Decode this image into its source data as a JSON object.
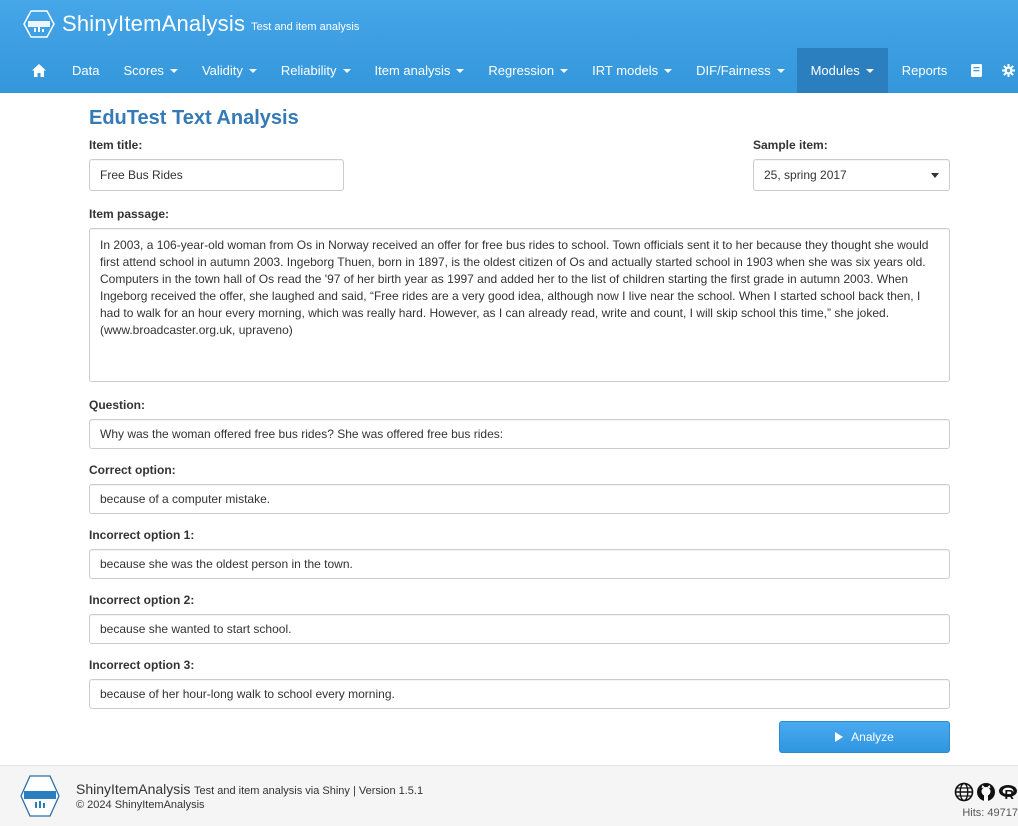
{
  "app": {
    "brand_name": "ShinyItemAnalysis",
    "brand_sub": "Test and item analysis"
  },
  "nav": {
    "home_icon": "home-icon",
    "items": [
      {
        "label": "Data",
        "dropdown": false
      },
      {
        "label": "Scores",
        "dropdown": true
      },
      {
        "label": "Validity",
        "dropdown": true
      },
      {
        "label": "Reliability",
        "dropdown": true
      },
      {
        "label": "Item analysis",
        "dropdown": true
      },
      {
        "label": "Regression",
        "dropdown": true
      },
      {
        "label": "IRT models",
        "dropdown": true
      },
      {
        "label": "DIF/Fairness",
        "dropdown": true
      },
      {
        "label": "Modules",
        "dropdown": true,
        "active": true
      }
    ],
    "reports_label": "Reports",
    "book_icon": "book-icon",
    "gear_icon": "gear-icon"
  },
  "page": {
    "title": "EduTest Text Analysis",
    "item_title_label": "Item title:",
    "item_title_value": "Free Bus Rides",
    "sample_item_label": "Sample item:",
    "sample_item_value": "25, spring 2017",
    "passage_label": "Item passage:",
    "passage_value": "In 2003, a 106-year-old woman from Os in Norway received an offer for free bus rides to school. Town officials sent it to her because they thought she would first attend school in autumn 2003. Ingeborg Thuen, born in 1897, is the oldest citizen of Os and actually started school in 1903 when she was six years old. Computers in the town hall of Os read the '97 of her birth year as 1997 and added her to the list of children starting the first grade in autumn 2003. When Ingeborg received the offer, she laughed and said, “Free rides are a very good idea, although now I live near the school. When I started school back then, I had to walk for an hour every morning, which was really hard. However, as I can already read, write and count, I will skip school this time,” she joked. (www.broadcaster.org.uk, upraveno)",
    "question_label": "Question:",
    "question_value": "Why was the woman offered free bus rides? She was offered free bus rides:",
    "correct_label": "Correct option:",
    "correct_value": "because of a computer mistake.",
    "incorrect1_label": "Incorrect option 1:",
    "incorrect1_value": "because she was the oldest person in the town.",
    "incorrect2_label": "Incorrect option 2:",
    "incorrect2_value": "because she wanted to start school.",
    "incorrect3_label": "Incorrect option 3:",
    "incorrect3_value": "because of her hour-long walk to school every morning.",
    "analyze_label": "Analyze"
  },
  "footer": {
    "name": "ShinyItemAnalysis",
    "sub": "Test and item analysis via Shiny | Version 1.5.1",
    "copyright": "© 2024 ShinyItemAnalysis",
    "hits": "Hits: 49717",
    "icons": [
      "globe-icon",
      "github-icon",
      "r-icon"
    ]
  },
  "colors": {
    "header": "#3d9ee0",
    "nav_active": "#2b7fbf",
    "title": "#337ab7",
    "button": "#2f96e0"
  }
}
